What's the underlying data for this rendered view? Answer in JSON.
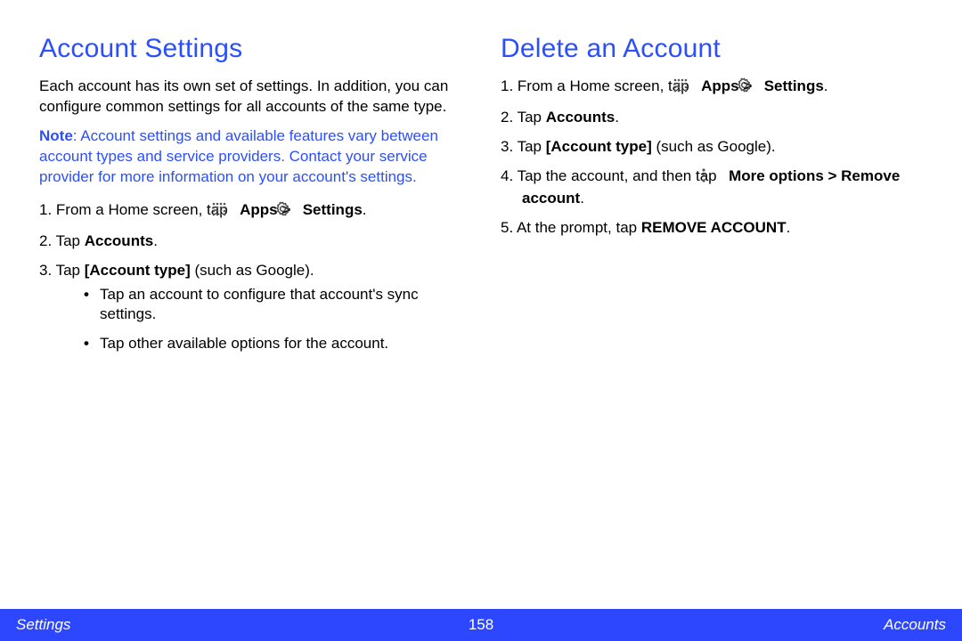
{
  "left": {
    "heading": "Account Settings",
    "intro": "Each account has its own set of settings. In addition, you can configure common settings for all accounts of the same type.",
    "note_label": "Note",
    "note_body": ": Account settings and available features vary between account types and service providers. Contact your service provider for more information on your account's settings.",
    "steps": {
      "s1_num": "1. ",
      "s1_a": "From a Home screen, tap ",
      "s1_apps": "Apps > ",
      "s1_settings": "Settings",
      "s1_end": ".",
      "s2_num": "2. ",
      "s2_a": "Tap ",
      "s2_b": "Accounts",
      "s2_end": ".",
      "s3_num": "3. ",
      "s3_a": "Tap ",
      "s3_b": "[Account type]",
      "s3_c": " (such as Google).",
      "bullets": {
        "b1": "Tap an account to configure that account's sync settings.",
        "b2": "Tap other available options for the account."
      }
    }
  },
  "right": {
    "heading": "Delete an Account",
    "steps": {
      "s1_num": "1. ",
      "s1_a": "From a Home screen, tap ",
      "s1_apps": "Apps > ",
      "s1_settings": "Settings",
      "s1_end": ".",
      "s2_num": "2. ",
      "s2_a": "Tap ",
      "s2_b": "Accounts",
      "s2_end": ".",
      "s3_num": "3. ",
      "s3_a": "Tap ",
      "s3_b": "[Account type]",
      "s3_c": " (such as Google).",
      "s4_num": "4. ",
      "s4_a": "Tap the account, and then tap ",
      "s4_b": "More options > Remove account",
      "s4_end": ".",
      "s5_num": "5. ",
      "s5_a": "At the prompt, tap ",
      "s5_b": "REMOVE ACCOUNT",
      "s5_end": "."
    }
  },
  "footer": {
    "left": "Settings",
    "center": "158",
    "right": "Accounts"
  }
}
